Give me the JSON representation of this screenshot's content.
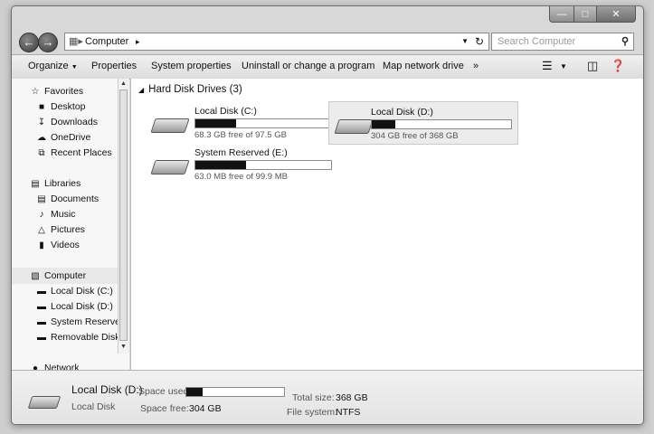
{
  "navigation": {
    "breadcrumb": "Computer",
    "search_placeholder": "Search Computer"
  },
  "toolbar": {
    "items": [
      "Organize",
      "Properties",
      "System properties",
      "Uninstall or change a program",
      "Map network drive"
    ]
  },
  "sidebar": {
    "favorites": {
      "label": "Favorites",
      "items": [
        "Desktop",
        "Downloads",
        "OneDrive",
        "Recent Places"
      ]
    },
    "libraries": {
      "label": "Libraries",
      "items": [
        "Documents",
        "Music",
        "Pictures",
        "Videos"
      ]
    },
    "computer": {
      "label": "Computer",
      "items": [
        "Local Disk (C:)",
        "Local Disk (D:)",
        "System Reserved",
        "Removable Disk ("
      ]
    },
    "network": {
      "label": "Network"
    }
  },
  "content": {
    "group_title": "Hard Disk Drives (3)",
    "drives": [
      {
        "name": "Local Disk (C:)",
        "free_text": "68.3 GB free of 97.5 GB",
        "used_fraction": 0.3,
        "selected": false
      },
      {
        "name": "Local Disk (D:)",
        "free_text": "304 GB free of 368 GB",
        "used_fraction": 0.17,
        "selected": true
      },
      {
        "name": "System Reserved (E:)",
        "free_text": "63.0 MB free of 99.9 MB",
        "used_fraction": 0.37,
        "selected": false
      }
    ]
  },
  "details": {
    "name": "Local Disk (D:)",
    "type": "Local Disk",
    "space_used_label": "Space used:",
    "space_used_fraction": 0.17,
    "space_free_label": "Space free:",
    "space_free_value": "304 GB",
    "total_size_label": "Total size:",
    "total_size_value": "368 GB",
    "file_system_label": "File system:",
    "file_system_value": "NTFS"
  }
}
